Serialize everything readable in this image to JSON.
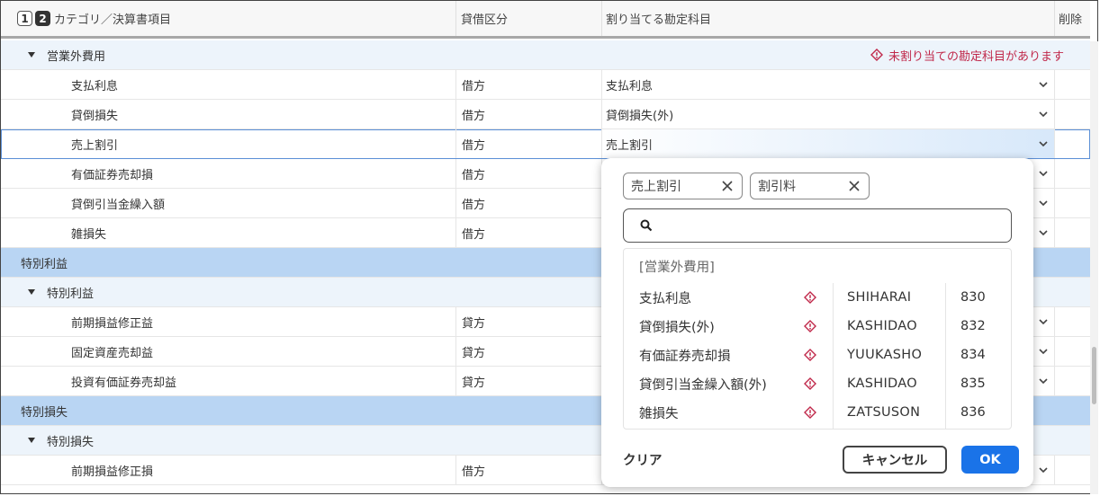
{
  "header": {
    "level1": "1",
    "level2": "2",
    "col_category": "カテゴリ／決算書項目",
    "col_debit_credit": "貸借区分",
    "col_assign": "割り当てる勘定科目",
    "col_delete": "削除"
  },
  "rows": [
    {
      "kind": "group",
      "label": "営業外費用",
      "warning": "未割り当ての勘定科目があります"
    },
    {
      "kind": "item",
      "label": "支払利息",
      "dc": "借方",
      "assigned": "支払利息"
    },
    {
      "kind": "item",
      "label": "貸倒損失",
      "dc": "借方",
      "assigned": "貸倒損失(外)"
    },
    {
      "kind": "item",
      "label": "売上割引",
      "dc": "借方",
      "assigned": "売上割引"
    },
    {
      "kind": "item",
      "label": "有価証券売却損",
      "dc": "借方",
      "assigned": ""
    },
    {
      "kind": "item",
      "label": "貸倒引当金繰入額",
      "dc": "借方",
      "assigned": ""
    },
    {
      "kind": "item",
      "label": "雑損失",
      "dc": "借方",
      "assigned": ""
    },
    {
      "kind": "section",
      "label": "特別利益"
    },
    {
      "kind": "group",
      "label": "特別利益"
    },
    {
      "kind": "item",
      "label": "前期損益修正益",
      "dc": "貸方",
      "assigned": ""
    },
    {
      "kind": "item",
      "label": "固定資産売却益",
      "dc": "貸方",
      "assigned": ""
    },
    {
      "kind": "item",
      "label": "投資有価証券売却益",
      "dc": "貸方",
      "assigned": ""
    },
    {
      "kind": "section",
      "label": "特別損失"
    },
    {
      "kind": "group",
      "label": "特別損失"
    },
    {
      "kind": "item",
      "label": "前期損益修正損",
      "dc": "借方",
      "assigned": ""
    }
  ],
  "popup": {
    "chips": [
      "売上割引",
      "割引料"
    ],
    "search_value": "",
    "group_label": "[営業外費用]",
    "items": [
      {
        "name": "支払利息",
        "code": "SHIHARAI",
        "no": "830"
      },
      {
        "name": "貸倒損失(外)",
        "code": "KASHIDAO",
        "no": "832"
      },
      {
        "name": "有価証券売却損",
        "code": "YUUKASHO",
        "no": "834"
      },
      {
        "name": "貸倒引当金繰入額(外)",
        "code": "KASHIDAO",
        "no": "835"
      },
      {
        "name": "雑損失",
        "code": "ZATSUSON",
        "no": "836"
      }
    ],
    "clear_label": "クリア",
    "cancel_label": "キャンセル",
    "ok_label": "OK"
  },
  "colors": {
    "group_bg": "#edf4fb",
    "section_bg": "#b9d5f3",
    "warning": "#c0284a",
    "ok_button": "#1a73e8"
  },
  "icons": [
    "caret-down-icon",
    "warning-diamond-icon",
    "chevron-down-icon",
    "close-icon",
    "search-icon"
  ]
}
